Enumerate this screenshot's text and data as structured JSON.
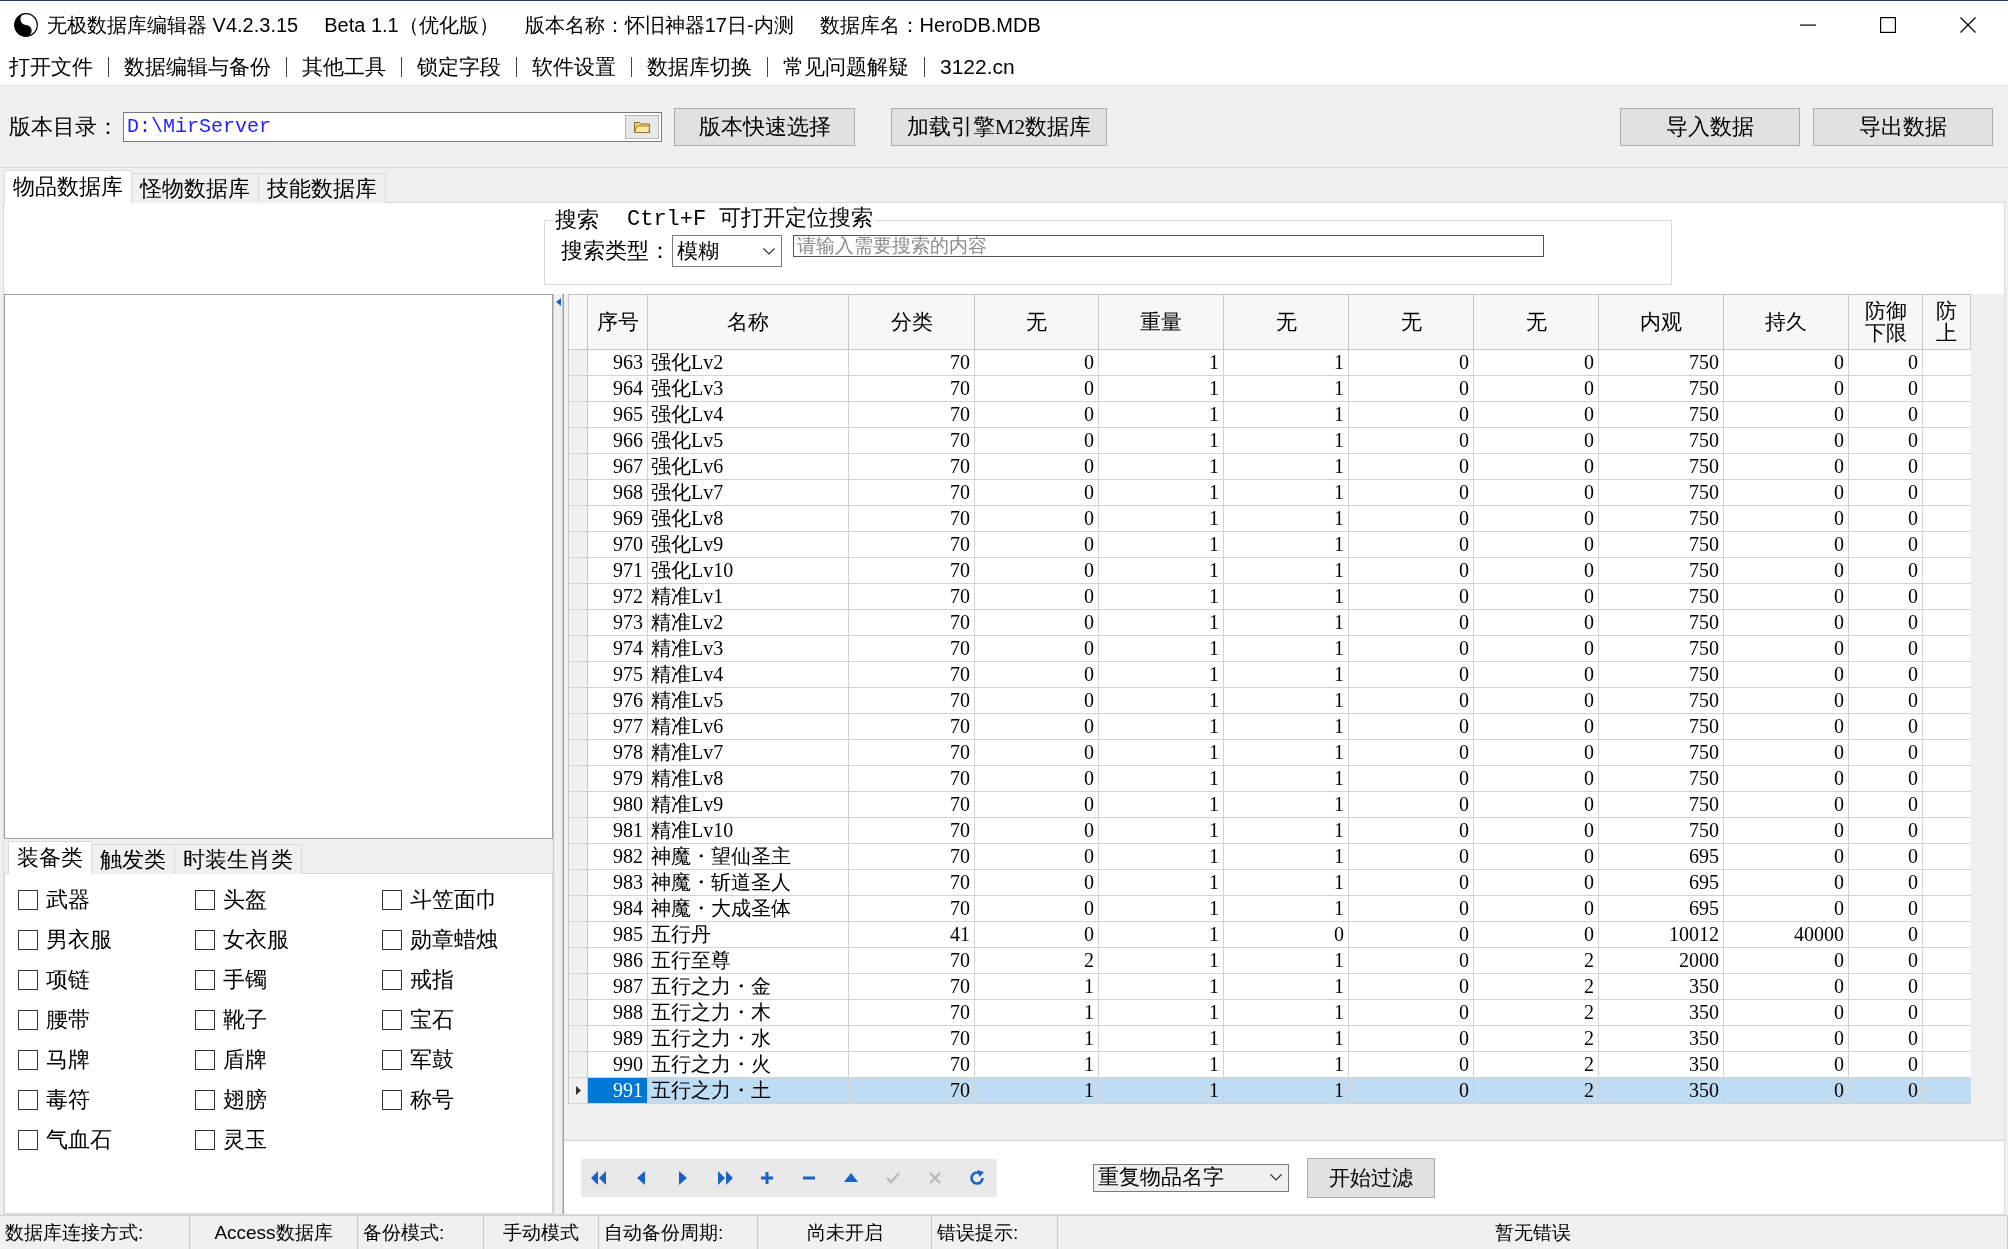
{
  "window": {
    "title_parts": [
      "无极数据库编辑器 V4.2.3.15",
      "Beta 1.1（优化版）",
      "版本名称：怀旧神器17日-内测",
      "数据库名：HeroDB.MDB"
    ]
  },
  "menu": [
    "打开文件",
    "数据编辑与备份",
    "其他工具",
    "锁定字段",
    "软件设置",
    "数据库切换",
    "常见问题解疑",
    "3122.cn"
  ],
  "toolbar": {
    "directory_label": "版本目录：",
    "directory": "D:\\MirServer",
    "buttons_left": [
      "版本快速选择",
      "加载引擎M2数据库"
    ],
    "buttons_right": [
      "导入数据",
      "导出数据"
    ]
  },
  "tabs": [
    {
      "label": "物品数据库",
      "selected": true
    },
    {
      "label": "怪物数据库",
      "selected": false
    },
    {
      "label": "技能数据库",
      "selected": false
    }
  ],
  "search": {
    "legend": "搜索",
    "hint": "Ctrl+F 可打开定位搜索",
    "type_label": "搜索类型：",
    "type_value": "模糊",
    "placeholder": "请输入需要搜索的内容"
  },
  "category_tabs": [
    {
      "label": "装备类",
      "selected": true
    },
    {
      "label": "触发类",
      "selected": false
    },
    {
      "label": "时装生肖类",
      "selected": false
    }
  ],
  "categories": [
    {
      "label": "武器",
      "checked": false
    },
    {
      "label": "头盔",
      "checked": false
    },
    {
      "label": "斗笠面巾",
      "checked": false
    },
    {
      "label": "男衣服",
      "checked": false
    },
    {
      "label": "女衣服",
      "checked": false
    },
    {
      "label": "勋章蜡烛",
      "checked": false
    },
    {
      "label": "项链",
      "checked": false
    },
    {
      "label": "手镯",
      "checked": false
    },
    {
      "label": "戒指",
      "checked": false
    },
    {
      "label": "腰带",
      "checked": false
    },
    {
      "label": "靴子",
      "checked": false
    },
    {
      "label": "宝石",
      "checked": false
    },
    {
      "label": "马牌",
      "checked": false
    },
    {
      "label": "盾牌",
      "checked": false
    },
    {
      "label": "军鼓",
      "checked": false
    },
    {
      "label": "毒符",
      "checked": false
    },
    {
      "label": "翅膀",
      "checked": false
    },
    {
      "label": "称号",
      "checked": false
    },
    {
      "label": "气血石",
      "checked": false
    },
    {
      "label": "灵玉",
      "checked": false
    }
  ],
  "table": {
    "columns": [
      "序号",
      "名称",
      "分类",
      "无",
      "重量",
      "无",
      "无",
      "无",
      "内观",
      "持久",
      "防御下限",
      "防上"
    ],
    "rows": [
      {
        "cells": [
          "963",
          "强化Lv2",
          "70",
          "0",
          "1",
          "1",
          "0",
          "0",
          "750",
          "0",
          "0"
        ],
        "selected": false
      },
      {
        "cells": [
          "964",
          "强化Lv3",
          "70",
          "0",
          "1",
          "1",
          "0",
          "0",
          "750",
          "0",
          "0"
        ],
        "selected": false
      },
      {
        "cells": [
          "965",
          "强化Lv4",
          "70",
          "0",
          "1",
          "1",
          "0",
          "0",
          "750",
          "0",
          "0"
        ],
        "selected": false
      },
      {
        "cells": [
          "966",
          "强化Lv5",
          "70",
          "0",
          "1",
          "1",
          "0",
          "0",
          "750",
          "0",
          "0"
        ],
        "selected": false
      },
      {
        "cells": [
          "967",
          "强化Lv6",
          "70",
          "0",
          "1",
          "1",
          "0",
          "0",
          "750",
          "0",
          "0"
        ],
        "selected": false
      },
      {
        "cells": [
          "968",
          "强化Lv7",
          "70",
          "0",
          "1",
          "1",
          "0",
          "0",
          "750",
          "0",
          "0"
        ],
        "selected": false
      },
      {
        "cells": [
          "969",
          "强化Lv8",
          "70",
          "0",
          "1",
          "1",
          "0",
          "0",
          "750",
          "0",
          "0"
        ],
        "selected": false
      },
      {
        "cells": [
          "970",
          "强化Lv9",
          "70",
          "0",
          "1",
          "1",
          "0",
          "0",
          "750",
          "0",
          "0"
        ],
        "selected": false
      },
      {
        "cells": [
          "971",
          "强化Lv10",
          "70",
          "0",
          "1",
          "1",
          "0",
          "0",
          "750",
          "0",
          "0"
        ],
        "selected": false
      },
      {
        "cells": [
          "972",
          "精准Lv1",
          "70",
          "0",
          "1",
          "1",
          "0",
          "0",
          "750",
          "0",
          "0"
        ],
        "selected": false
      },
      {
        "cells": [
          "973",
          "精准Lv2",
          "70",
          "0",
          "1",
          "1",
          "0",
          "0",
          "750",
          "0",
          "0"
        ],
        "selected": false
      },
      {
        "cells": [
          "974",
          "精准Lv3",
          "70",
          "0",
          "1",
          "1",
          "0",
          "0",
          "750",
          "0",
          "0"
        ],
        "selected": false
      },
      {
        "cells": [
          "975",
          "精准Lv4",
          "70",
          "0",
          "1",
          "1",
          "0",
          "0",
          "750",
          "0",
          "0"
        ],
        "selected": false
      },
      {
        "cells": [
          "976",
          "精准Lv5",
          "70",
          "0",
          "1",
          "1",
          "0",
          "0",
          "750",
          "0",
          "0"
        ],
        "selected": false
      },
      {
        "cells": [
          "977",
          "精准Lv6",
          "70",
          "0",
          "1",
          "1",
          "0",
          "0",
          "750",
          "0",
          "0"
        ],
        "selected": false
      },
      {
        "cells": [
          "978",
          "精准Lv7",
          "70",
          "0",
          "1",
          "1",
          "0",
          "0",
          "750",
          "0",
          "0"
        ],
        "selected": false
      },
      {
        "cells": [
          "979",
          "精准Lv8",
          "70",
          "0",
          "1",
          "1",
          "0",
          "0",
          "750",
          "0",
          "0"
        ],
        "selected": false
      },
      {
        "cells": [
          "980",
          "精准Lv9",
          "70",
          "0",
          "1",
          "1",
          "0",
          "0",
          "750",
          "0",
          "0"
        ],
        "selected": false
      },
      {
        "cells": [
          "981",
          "精准Lv10",
          "70",
          "0",
          "1",
          "1",
          "0",
          "0",
          "750",
          "0",
          "0"
        ],
        "selected": false
      },
      {
        "cells": [
          "982",
          "神魔・望仙圣主",
          "70",
          "0",
          "1",
          "1",
          "0",
          "0",
          "695",
          "0",
          "0"
        ],
        "selected": false
      },
      {
        "cells": [
          "983",
          "神魔・斩道圣人",
          "70",
          "0",
          "1",
          "1",
          "0",
          "0",
          "695",
          "0",
          "0"
        ],
        "selected": false
      },
      {
        "cells": [
          "984",
          "神魔・大成圣体",
          "70",
          "0",
          "1",
          "1",
          "0",
          "0",
          "695",
          "0",
          "0"
        ],
        "selected": false
      },
      {
        "cells": [
          "985",
          "五行丹",
          "41",
          "0",
          "1",
          "0",
          "0",
          "0",
          "10012",
          "40000",
          "0"
        ],
        "selected": false
      },
      {
        "cells": [
          "986",
          "五行至尊",
          "70",
          "2",
          "1",
          "1",
          "0",
          "2",
          "2000",
          "0",
          "0"
        ],
        "selected": false
      },
      {
        "cells": [
          "987",
          "五行之力・金",
          "70",
          "1",
          "1",
          "1",
          "0",
          "2",
          "350",
          "0",
          "0"
        ],
        "selected": false
      },
      {
        "cells": [
          "988",
          "五行之力・木",
          "70",
          "1",
          "1",
          "1",
          "0",
          "2",
          "350",
          "0",
          "0"
        ],
        "selected": false
      },
      {
        "cells": [
          "989",
          "五行之力・水",
          "70",
          "1",
          "1",
          "1",
          "0",
          "2",
          "350",
          "0",
          "0"
        ],
        "selected": false
      },
      {
        "cells": [
          "990",
          "五行之力・火",
          "70",
          "1",
          "1",
          "1",
          "0",
          "2",
          "350",
          "0",
          "0"
        ],
        "selected": false
      },
      {
        "cells": [
          "991",
          "五行之力・土",
          "70",
          "1",
          "1",
          "1",
          "0",
          "2",
          "350",
          "0",
          "0"
        ],
        "selected": true
      }
    ]
  },
  "navigator": [
    {
      "kind": "first",
      "disabled": false
    },
    {
      "kind": "prior",
      "disabled": false
    },
    {
      "kind": "next",
      "disabled": false
    },
    {
      "kind": "last",
      "disabled": false
    },
    {
      "kind": "insert",
      "disabled": false
    },
    {
      "kind": "delete",
      "disabled": false
    },
    {
      "kind": "edit",
      "disabled": false
    },
    {
      "kind": "post",
      "disabled": true
    },
    {
      "kind": "cancel",
      "disabled": true
    },
    {
      "kind": "refresh",
      "disabled": false
    }
  ],
  "filter": {
    "dropdown_value": "重复物品名字",
    "button": "开始过滤"
  },
  "status_bar": [
    {
      "label": "数据库连接方式:",
      "value": "Access数据库"
    },
    {
      "label": "备份模式:",
      "value": "手动模式"
    },
    {
      "label": "自动备份周期:",
      "value": "尚未开启"
    },
    {
      "label": "错误提示:",
      "value": "暂无错误"
    }
  ]
}
